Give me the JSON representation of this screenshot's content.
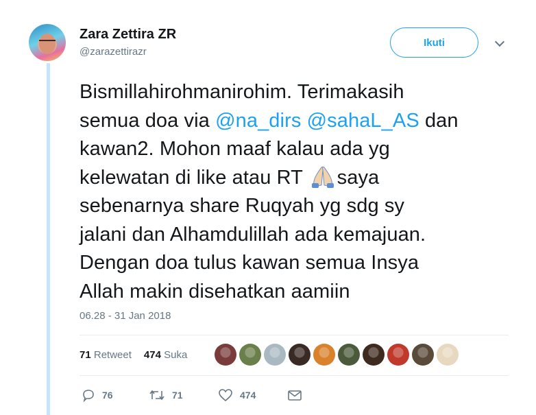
{
  "author": {
    "name": "Zara Zettira ZR",
    "handle": "@zarazettirazr"
  },
  "follow_label": "Ikuti",
  "tweet": {
    "line1": "Bismillahirohmanirohim. Terimakasih",
    "line2_pre": "semua doa via  ",
    "mention1": "@na_dirs",
    "mention2": "@sahaL_AS",
    "line2_post": " dan",
    "line3": "kawan2. Mohon maaf kalau ada yg",
    "line4_pre": "kelewatan di like atau RT ",
    "line4_post": "saya",
    "line5": "sebenarnya share Ruqyah yg sdg sy",
    "line6": "jalani dan Alhamdulillah ada kemajuan.",
    "line7": "Dengan doa tulus kawan semua Insya",
    "line8": "Allah makin disehatkan aamiin",
    "emoji": "folded-hands-icon"
  },
  "timestamp": "06.28 - 31 Jan 2018",
  "stats": {
    "retweet_count": "71",
    "retweet_label": "Retweet",
    "like_count": "474",
    "like_label": "Suka"
  },
  "likers_colors": [
    "#7a3b3b",
    "#6b7f4a",
    "#aab8c2",
    "#3a2a24",
    "#d9822b",
    "#4a5a3a",
    "#3d2b1f",
    "#c0392b",
    "#5a4a3a",
    "#e8d8c0"
  ],
  "actions": {
    "reply_count": "76",
    "retweet_count": "71",
    "like_count": "474"
  },
  "colors": {
    "accent": "#1da1f2",
    "thread_line": "#c4e5fb",
    "muted": "#657786"
  }
}
